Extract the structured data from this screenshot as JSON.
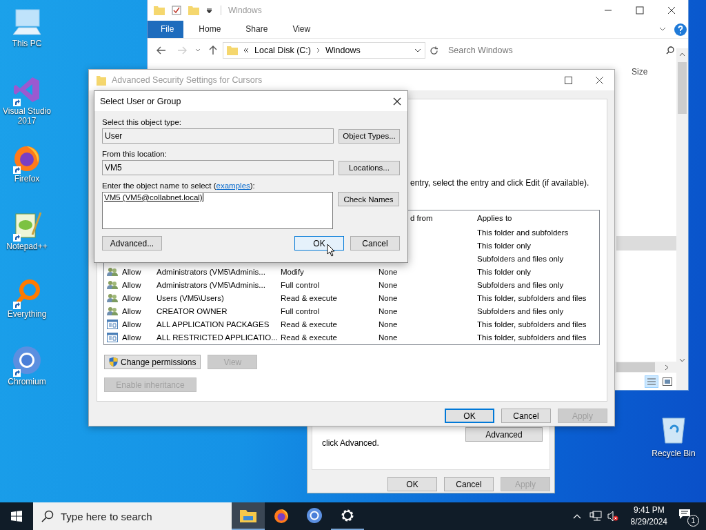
{
  "desktop_icons": [
    {
      "kind": "pc",
      "label": "This PC",
      "shortcut": false
    },
    {
      "kind": "vs",
      "label": "Visual Studio 2017",
      "shortcut": true
    },
    {
      "kind": "firefox",
      "label": "Firefox",
      "shortcut": true
    },
    {
      "kind": "notepad",
      "label": "Notepad++",
      "shortcut": true
    },
    {
      "kind": "everything",
      "label": "Everything",
      "shortcut": true
    },
    {
      "kind": "chromium",
      "label": "Chromium",
      "shortcut": true
    }
  ],
  "recycle_bin": {
    "label": "Recycle Bin"
  },
  "explorer": {
    "title": "Windows",
    "tabs": [
      {
        "label": "File",
        "selected": true
      },
      {
        "label": "Home",
        "selected": false
      },
      {
        "label": "Share",
        "selected": false
      },
      {
        "label": "View",
        "selected": false
      }
    ],
    "path": [
      "Local Disk (C:)",
      "Windows"
    ],
    "search": {
      "placeholder": "Search Windows"
    },
    "columns": [
      "Size"
    ]
  },
  "properties_window": {
    "note": "click Advanced.",
    "advanced_button": "Advanced",
    "buttons": [
      {
        "label": "OK",
        "disabled": false,
        "default": false
      },
      {
        "label": "Cancel",
        "disabled": false,
        "default": false
      },
      {
        "label": "Apply",
        "disabled": true,
        "default": false
      }
    ]
  },
  "security_window": {
    "title": "Advanced Security Settings for Cursors",
    "instruction": "entry, select the entry and click Edit (if available).",
    "columns": {
      "inherited_from": "d from",
      "applies_to": "Applies to"
    },
    "entries": [
      {
        "applies_to": "This folder and subfolders"
      },
      {
        "applies_to": "This folder only"
      },
      {
        "applies_to": "Subfolders and files only"
      },
      {
        "kind": "group",
        "type": "Allow",
        "principal": "Administrators (VM5\\Adminis...",
        "access": "Modify",
        "inherited_from": "None",
        "applies_to": "This folder only"
      },
      {
        "kind": "group",
        "type": "Allow",
        "principal": "Administrators (VM5\\Adminis...",
        "access": "Full control",
        "inherited_from": "None",
        "applies_to": "Subfolders and files only"
      },
      {
        "kind": "group",
        "type": "Allow",
        "principal": "Users (VM5\\Users)",
        "access": "Read & execute",
        "inherited_from": "None",
        "applies_to": "This folder, subfolders and files"
      },
      {
        "kind": "group",
        "type": "Allow",
        "principal": "CREATOR OWNER",
        "access": "Full control",
        "inherited_from": "None",
        "applies_to": "Subfolders and files only"
      },
      {
        "kind": "package",
        "type": "Allow",
        "principal": "ALL APPLICATION PACKAGES",
        "access": "Read & execute",
        "inherited_from": "None",
        "applies_to": "This folder, subfolders and files"
      },
      {
        "kind": "package",
        "type": "Allow",
        "principal": "ALL RESTRICTED APPLICATIO...",
        "access": "Read & execute",
        "inherited_from": "None",
        "applies_to": "This folder, subfolders and files"
      }
    ],
    "change_permissions": "Change permissions",
    "view_button": {
      "label": "View",
      "disabled": true
    },
    "inheritance_button": {
      "label": "Enable inheritance",
      "disabled": true
    },
    "buttons": [
      {
        "label": "OK",
        "disabled": false,
        "default": true
      },
      {
        "label": "Cancel",
        "disabled": false,
        "default": false
      },
      {
        "label": "Apply",
        "disabled": true,
        "default": false
      }
    ]
  },
  "select_dialog": {
    "title": "Select User or Group",
    "type_label": "Select this object type:",
    "type_value": "User",
    "type_button": "Object Types...",
    "location_label": "From this location:",
    "location_value": "VM5",
    "location_button": "Locations...",
    "name_label_before": "Enter the object name to select (",
    "name_link": "examples",
    "name_label_after": "):",
    "name_value": "VM5 (VM5@collabnet.local)",
    "check_button": "Check Names",
    "advanced_button": "Advanced...",
    "buttons": [
      {
        "label": "OK",
        "disabled": false,
        "default": true
      },
      {
        "label": "Cancel",
        "disabled": false,
        "default": false
      }
    ]
  },
  "taskbar": {
    "search": {
      "placeholder": "Type here to search"
    },
    "apps": [
      {
        "kind": "explorer",
        "active": true,
        "running": true
      },
      {
        "kind": "firefox",
        "active": false,
        "running": false
      },
      {
        "kind": "chromium",
        "active": false,
        "running": false
      },
      {
        "kind": "settings",
        "active": false,
        "running": true
      }
    ],
    "time": "9:41 PM",
    "date": "8/29/2024",
    "notification_count": "1"
  }
}
